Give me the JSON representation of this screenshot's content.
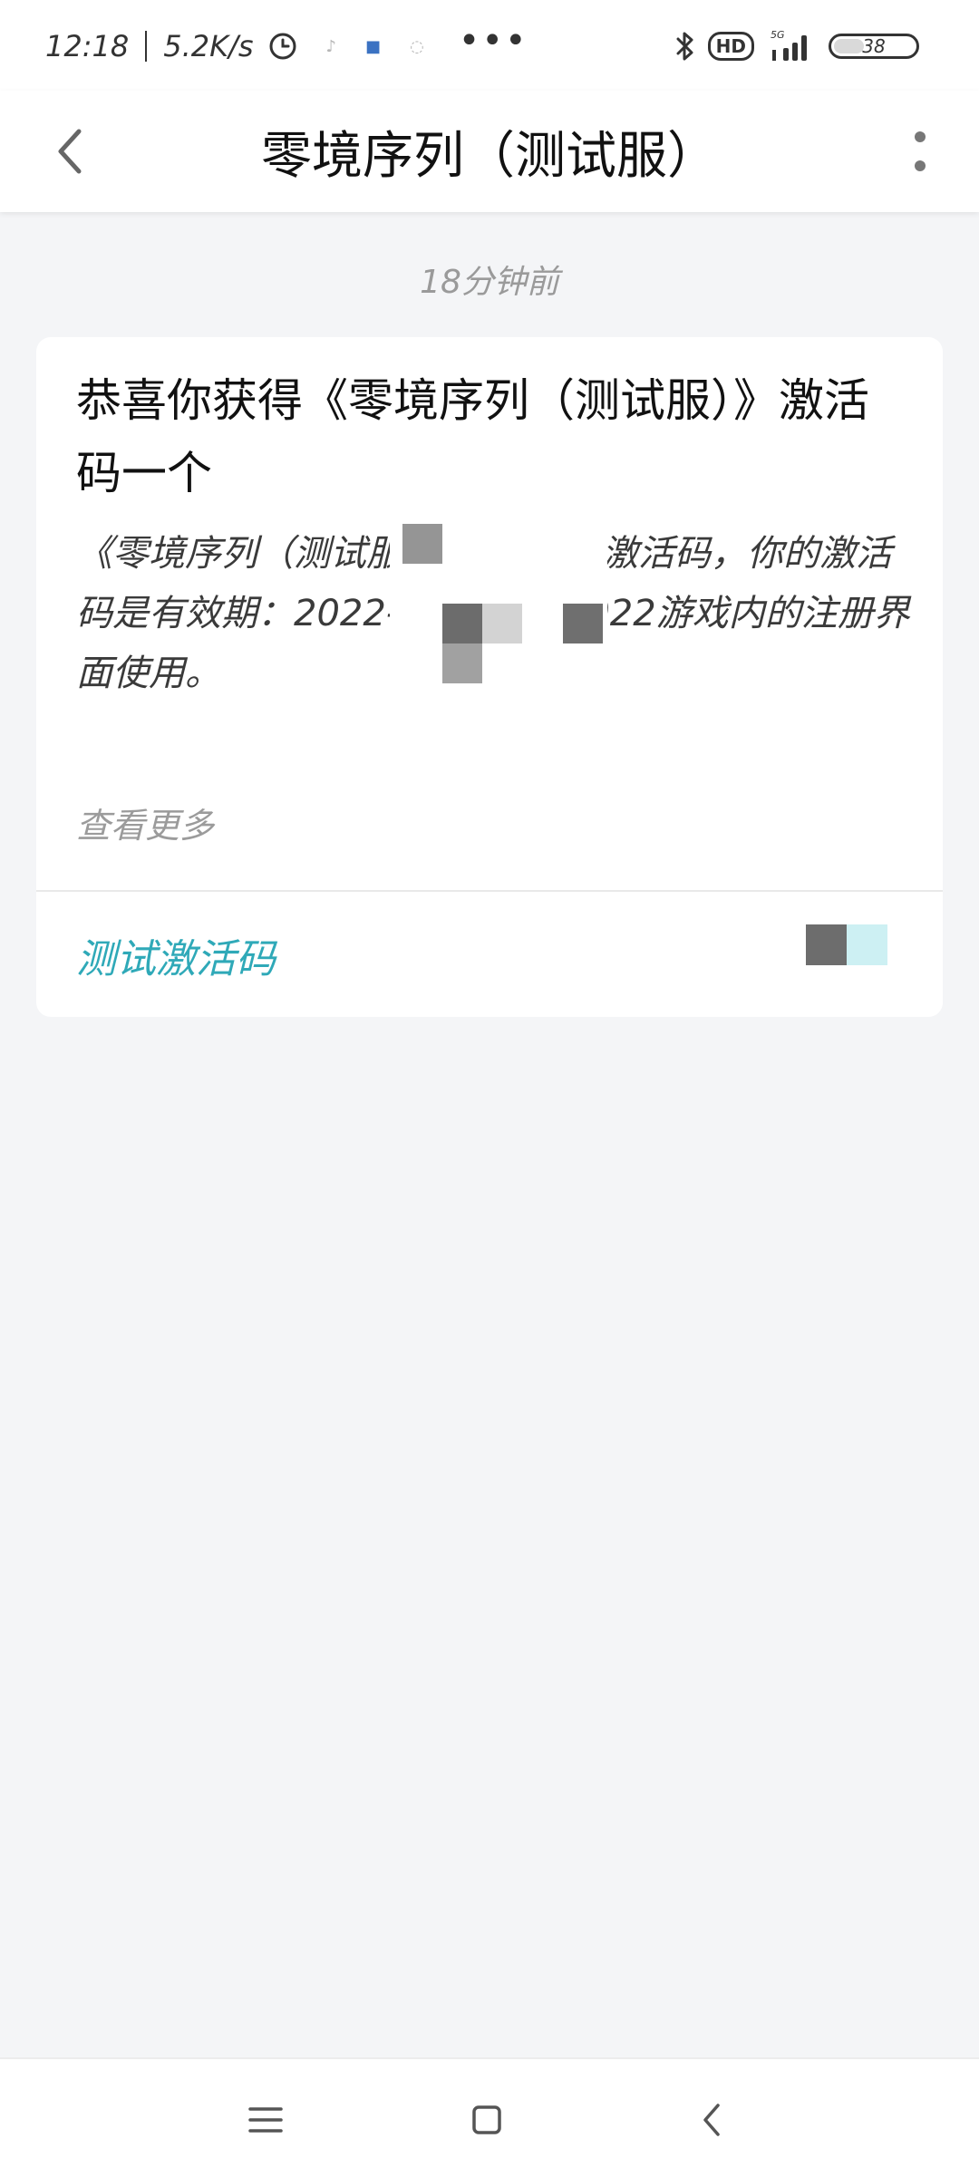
{
  "status_bar": {
    "time": "12:18",
    "net_speed": "5.2K/s",
    "more": "•••",
    "battery_percent": "38",
    "battery_level": 0.38,
    "hd_label": "HD",
    "network_label": "5G"
  },
  "header": {
    "title": "零境序列（测试服）",
    "back_icon": "chevron-left-icon",
    "menu_icon": "more-vertical-icon"
  },
  "message": {
    "timestamp": "18分钟前",
    "title": "恭喜你获得《零境序列（测试服）》激活码一个",
    "body": "《零境序列（测试服）》测试需要激活码，你的激活码是有效期：2022-08-15 至 2022游戏内的注册界面使用。",
    "view_more": "查看更多",
    "action_label": "测试激活码"
  },
  "nav_bar": {
    "menu_icon": "hamburger-menu-icon",
    "home_icon": "home-square-icon",
    "back_icon": "nav-back-icon"
  },
  "colors": {
    "accent": "#2fa9b8",
    "background": "#f4f5f7",
    "card": "#ffffff",
    "muted_text": "#9a9a9a"
  }
}
